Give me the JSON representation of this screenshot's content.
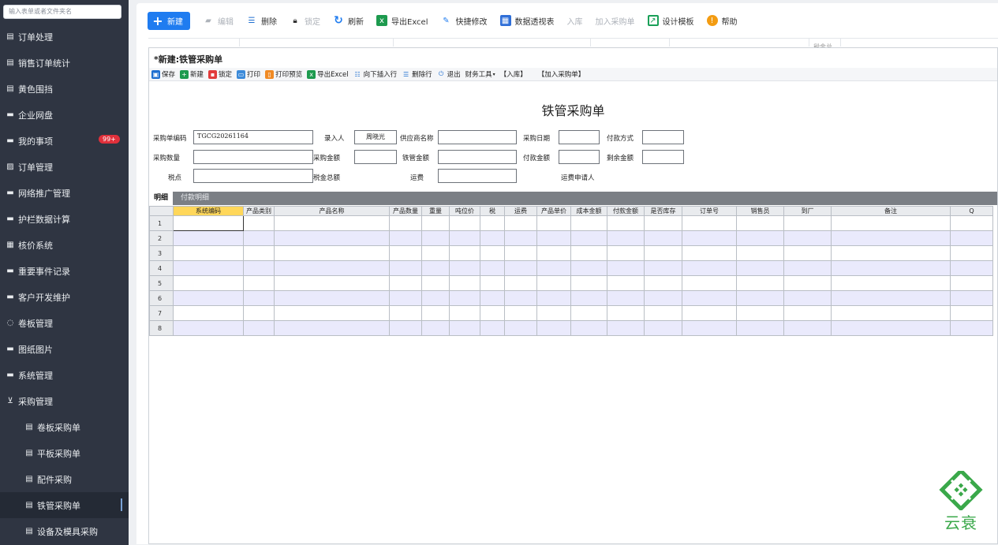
{
  "sidebar": {
    "search_placeholder": "输入表单或者文件夹名",
    "items": [
      {
        "label": "订单处理",
        "icon": "document-icon",
        "glyph": "▤"
      },
      {
        "label": "销售订单统计",
        "icon": "document-icon",
        "glyph": "▤"
      },
      {
        "label": "黄色围挡",
        "icon": "document-icon",
        "glyph": "▤"
      },
      {
        "label": "企业网盘",
        "icon": "folder-icon",
        "glyph": "▬"
      },
      {
        "label": "我的事项",
        "icon": "folder-icon",
        "glyph": "▬",
        "badge": "99+"
      },
      {
        "label": "订单管理",
        "icon": "edit-doc-icon",
        "glyph": "▨"
      },
      {
        "label": "网络推广管理",
        "icon": "folder-icon",
        "glyph": "▬"
      },
      {
        "label": "护栏数据计算",
        "icon": "folder-icon",
        "glyph": "▬"
      },
      {
        "label": "核价系统",
        "icon": "grid-icon",
        "glyph": "▦"
      },
      {
        "label": "重要事件记录",
        "icon": "folder-icon",
        "glyph": "▬"
      },
      {
        "label": "客户开发维护",
        "icon": "folder-icon",
        "glyph": "▬"
      },
      {
        "label": "卷板管理",
        "icon": "loading-icon",
        "glyph": "◌"
      },
      {
        "label": "图纸图片",
        "icon": "folder-icon",
        "glyph": "▬"
      },
      {
        "label": "系统管理",
        "icon": "folder-icon",
        "glyph": "▬"
      },
      {
        "label": "采购管理",
        "icon": "cart-icon",
        "glyph": "⊻"
      },
      {
        "label": "卷板采购单",
        "icon": "document-icon",
        "glyph": "▤",
        "sub": true
      },
      {
        "label": "平板采购单",
        "icon": "document-icon",
        "glyph": "▤",
        "sub": true
      },
      {
        "label": "配件采购",
        "icon": "document-icon",
        "glyph": "▤",
        "sub": true
      },
      {
        "label": "铁管采购单",
        "icon": "document-icon",
        "glyph": "▤",
        "sub": true,
        "active": true
      },
      {
        "label": "设备及模具采购",
        "icon": "document-icon",
        "glyph": "▤",
        "sub": true
      }
    ]
  },
  "toolbar": {
    "new": "新建",
    "edit": "编辑",
    "delete": "删除",
    "lock": "锁定",
    "refresh": "刷新",
    "export_excel": "导出Excel",
    "quick_edit": "快捷修改",
    "pivot": "数据透视表",
    "stock_in": "入库",
    "add_to_po": "加入采购单",
    "design_template": "设计模板",
    "help": "帮助"
  },
  "background_header_text": "税金总",
  "dialog": {
    "title": "*新建:铁管采购单",
    "toolbar": {
      "save": "保存",
      "new": "新建",
      "lock": "锁定",
      "print": "打印",
      "print_preview": "打印预览",
      "export_excel": "导出Excel",
      "insert_row": "向下插入行",
      "delete_row": "删除行",
      "exit": "退出",
      "finance_tools": "财务工具",
      "stock_in": "【入库】",
      "add_to_po": "【加入采购单】"
    },
    "form_title": "铁管采购单",
    "fields": {
      "po_code_label": "采购单编码",
      "po_code_value": "TGCG20261164",
      "entered_by_label": "录入人",
      "entered_by_value": "周晓光",
      "supplier_label": "供应商名称",
      "purchase_date_label": "采购日期",
      "payment_method_label": "付款方式",
      "purchase_qty_label": "采购数量",
      "purchase_amount_label": "采购金额",
      "pipe_amount_label": "铁管金额",
      "payment_amount_label": "付款金额",
      "remaining_amount_label": "剩余金额",
      "tax_point_label": "税点",
      "tax_total_label": "税金总额",
      "freight_label": "运费",
      "freight_applicant_label": "运费申请人"
    },
    "tabs": [
      "明细",
      "付款明细"
    ],
    "grid": {
      "columns": [
        "系统编码",
        "产品类别",
        "产品名称",
        "产品数量",
        "重量",
        "吨位价",
        "税",
        "运费",
        "产品单价",
        "成本金额",
        "付款金额",
        "是否库存",
        "订单号",
        "销售员",
        "到厂",
        "备注",
        "Q"
      ],
      "rows": [
        "1",
        "2",
        "3",
        "4",
        "5",
        "6",
        "7",
        "8"
      ]
    }
  },
  "logo": {
    "text": "云衰"
  }
}
